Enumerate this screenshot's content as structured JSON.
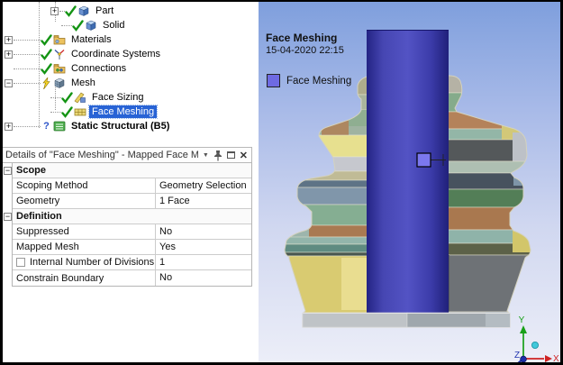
{
  "tree": {
    "items": [
      {
        "label": "Part"
      },
      {
        "label": "Solid"
      },
      {
        "label": "Materials"
      },
      {
        "label": "Coordinate Systems"
      },
      {
        "label": "Connections"
      },
      {
        "label": "Mesh"
      },
      {
        "label": "Face Sizing"
      },
      {
        "label": "Face Meshing",
        "selected": true
      },
      {
        "label": "Static Structural (B5)"
      }
    ]
  },
  "details": {
    "title": "Details of \"Face Meshing\" - Mapped Face M",
    "rows": [
      {
        "type": "section",
        "label": "Scope"
      },
      {
        "type": "row",
        "label": "Scoping Method",
        "value": "Geometry Selection"
      },
      {
        "type": "row",
        "label": "Geometry",
        "value": "1 Face"
      },
      {
        "type": "section",
        "label": "Definition"
      },
      {
        "type": "row",
        "label": "Suppressed",
        "value": "No"
      },
      {
        "type": "row",
        "label": "Mapped Mesh",
        "value": "Yes"
      },
      {
        "type": "row",
        "label": "Internal Number of Divisions",
        "value": "1",
        "checkbox": true
      },
      {
        "type": "row",
        "label": "Constrain Boundary",
        "value": "No"
      }
    ]
  },
  "viewport": {
    "annotation_title": "Face Meshing",
    "timestamp": "15-04-2020 22:15",
    "legend": {
      "label": "Face Meshing",
      "color": "#6e6ae2"
    },
    "triad": {
      "x": "X",
      "y": "Y",
      "z": "Z"
    },
    "colors": {
      "selected_face": "#4646b2",
      "selection_highlight": "#2863d5",
      "background_top": "#7f9fdd",
      "background_bottom": "#eceef8"
    }
  }
}
